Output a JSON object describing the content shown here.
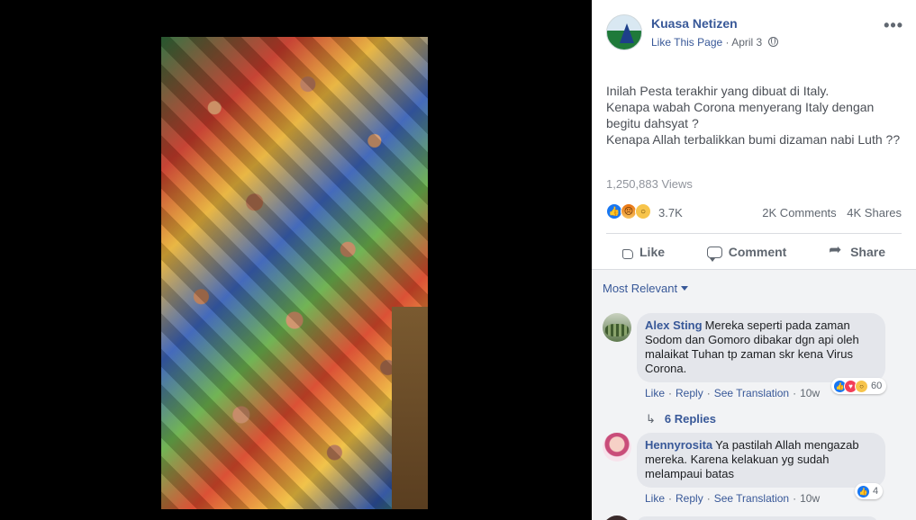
{
  "post": {
    "page_name": "Kuasa Netizen",
    "like_page": "Like This Page",
    "separator": "·",
    "date": "April 3",
    "text_lines": [
      "Inilah Pesta terakhir yang dibuat di Italy.",
      "Kenapa wabah Corona menyerang Italy dengan",
      "begitu dahsyat ?",
      "Kenapa Allah terbalikkan bumi dizaman nabi Luth ??"
    ],
    "views": "1,250,883 Views",
    "reaction_count": "3.7K",
    "comments_count": "2K Comments",
    "shares_count": "4K Shares",
    "reaction_icons": [
      "like-icon",
      "angry-icon",
      "wow-icon"
    ]
  },
  "actions": {
    "like": "Like",
    "comment": "Comment",
    "share": "Share"
  },
  "sort": {
    "label": "Most Relevant"
  },
  "comments": [
    {
      "author": "Alex Sting",
      "text": "Mereka seperti pada zaman Sodom dan Gomoro dibakar dgn api oleh malaikat Tuhan tp zaman skr kena Virus Corona.",
      "like": "Like",
      "reply": "Reply",
      "translation": "See Translation",
      "time": "10w",
      "reaction_count": "60"
    },
    {
      "author": "Hennyrosita",
      "text": "Ya pastilah Allah mengazab mereka. Karena kelakuan yg sudah melampaui batas",
      "like": "Like",
      "reply": "Reply",
      "translation": "See Translation",
      "time": "10w",
      "reaction_count": "4"
    }
  ],
  "replies": {
    "label": "6 Replies"
  },
  "colors": {
    "link": "#385898",
    "bubble": "#e4e6eb",
    "like_blue": "#1877f2"
  }
}
